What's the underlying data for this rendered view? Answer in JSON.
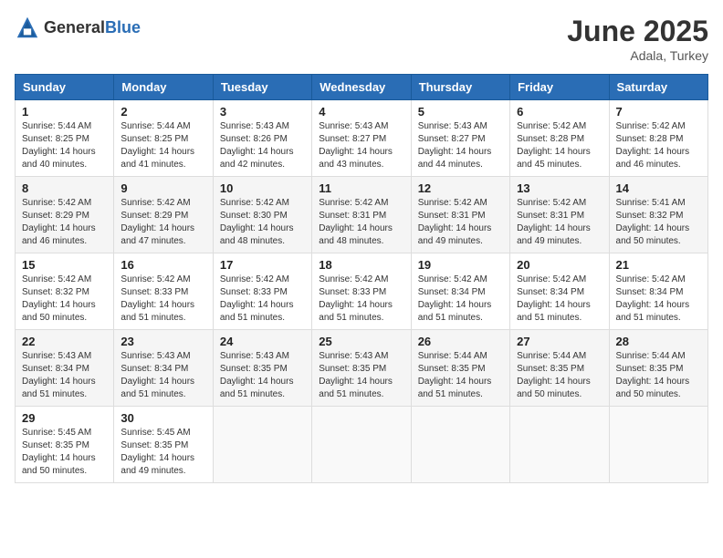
{
  "header": {
    "logo_general": "General",
    "logo_blue": "Blue",
    "month_year": "June 2025",
    "location": "Adala, Turkey"
  },
  "calendar": {
    "columns": [
      "Sunday",
      "Monday",
      "Tuesday",
      "Wednesday",
      "Thursday",
      "Friday",
      "Saturday"
    ],
    "weeks": [
      [
        {
          "day": "1",
          "sunrise": "5:44 AM",
          "sunset": "8:25 PM",
          "daylight": "14 hours and 40 minutes."
        },
        {
          "day": "2",
          "sunrise": "5:44 AM",
          "sunset": "8:25 PM",
          "daylight": "14 hours and 41 minutes."
        },
        {
          "day": "3",
          "sunrise": "5:43 AM",
          "sunset": "8:26 PM",
          "daylight": "14 hours and 42 minutes."
        },
        {
          "day": "4",
          "sunrise": "5:43 AM",
          "sunset": "8:27 PM",
          "daylight": "14 hours and 43 minutes."
        },
        {
          "day": "5",
          "sunrise": "5:43 AM",
          "sunset": "8:27 PM",
          "daylight": "14 hours and 44 minutes."
        },
        {
          "day": "6",
          "sunrise": "5:42 AM",
          "sunset": "8:28 PM",
          "daylight": "14 hours and 45 minutes."
        },
        {
          "day": "7",
          "sunrise": "5:42 AM",
          "sunset": "8:28 PM",
          "daylight": "14 hours and 46 minutes."
        }
      ],
      [
        {
          "day": "8",
          "sunrise": "5:42 AM",
          "sunset": "8:29 PM",
          "daylight": "14 hours and 46 minutes."
        },
        {
          "day": "9",
          "sunrise": "5:42 AM",
          "sunset": "8:29 PM",
          "daylight": "14 hours and 47 minutes."
        },
        {
          "day": "10",
          "sunrise": "5:42 AM",
          "sunset": "8:30 PM",
          "daylight": "14 hours and 48 minutes."
        },
        {
          "day": "11",
          "sunrise": "5:42 AM",
          "sunset": "8:31 PM",
          "daylight": "14 hours and 48 minutes."
        },
        {
          "day": "12",
          "sunrise": "5:42 AM",
          "sunset": "8:31 PM",
          "daylight": "14 hours and 49 minutes."
        },
        {
          "day": "13",
          "sunrise": "5:42 AM",
          "sunset": "8:31 PM",
          "daylight": "14 hours and 49 minutes."
        },
        {
          "day": "14",
          "sunrise": "5:41 AM",
          "sunset": "8:32 PM",
          "daylight": "14 hours and 50 minutes."
        }
      ],
      [
        {
          "day": "15",
          "sunrise": "5:42 AM",
          "sunset": "8:32 PM",
          "daylight": "14 hours and 50 minutes."
        },
        {
          "day": "16",
          "sunrise": "5:42 AM",
          "sunset": "8:33 PM",
          "daylight": "14 hours and 51 minutes."
        },
        {
          "day": "17",
          "sunrise": "5:42 AM",
          "sunset": "8:33 PM",
          "daylight": "14 hours and 51 minutes."
        },
        {
          "day": "18",
          "sunrise": "5:42 AM",
          "sunset": "8:33 PM",
          "daylight": "14 hours and 51 minutes."
        },
        {
          "day": "19",
          "sunrise": "5:42 AM",
          "sunset": "8:34 PM",
          "daylight": "14 hours and 51 minutes."
        },
        {
          "day": "20",
          "sunrise": "5:42 AM",
          "sunset": "8:34 PM",
          "daylight": "14 hours and 51 minutes."
        },
        {
          "day": "21",
          "sunrise": "5:42 AM",
          "sunset": "8:34 PM",
          "daylight": "14 hours and 51 minutes."
        }
      ],
      [
        {
          "day": "22",
          "sunrise": "5:43 AM",
          "sunset": "8:34 PM",
          "daylight": "14 hours and 51 minutes."
        },
        {
          "day": "23",
          "sunrise": "5:43 AM",
          "sunset": "8:34 PM",
          "daylight": "14 hours and 51 minutes."
        },
        {
          "day": "24",
          "sunrise": "5:43 AM",
          "sunset": "8:35 PM",
          "daylight": "14 hours and 51 minutes."
        },
        {
          "day": "25",
          "sunrise": "5:43 AM",
          "sunset": "8:35 PM",
          "daylight": "14 hours and 51 minutes."
        },
        {
          "day": "26",
          "sunrise": "5:44 AM",
          "sunset": "8:35 PM",
          "daylight": "14 hours and 51 minutes."
        },
        {
          "day": "27",
          "sunrise": "5:44 AM",
          "sunset": "8:35 PM",
          "daylight": "14 hours and 50 minutes."
        },
        {
          "day": "28",
          "sunrise": "5:44 AM",
          "sunset": "8:35 PM",
          "daylight": "14 hours and 50 minutes."
        }
      ],
      [
        {
          "day": "29",
          "sunrise": "5:45 AM",
          "sunset": "8:35 PM",
          "daylight": "14 hours and 50 minutes."
        },
        {
          "day": "30",
          "sunrise": "5:45 AM",
          "sunset": "8:35 PM",
          "daylight": "14 hours and 49 minutes."
        },
        null,
        null,
        null,
        null,
        null
      ]
    ],
    "labels": {
      "sunrise": "Sunrise: ",
      "sunset": "Sunset: ",
      "daylight": "Daylight: "
    }
  }
}
